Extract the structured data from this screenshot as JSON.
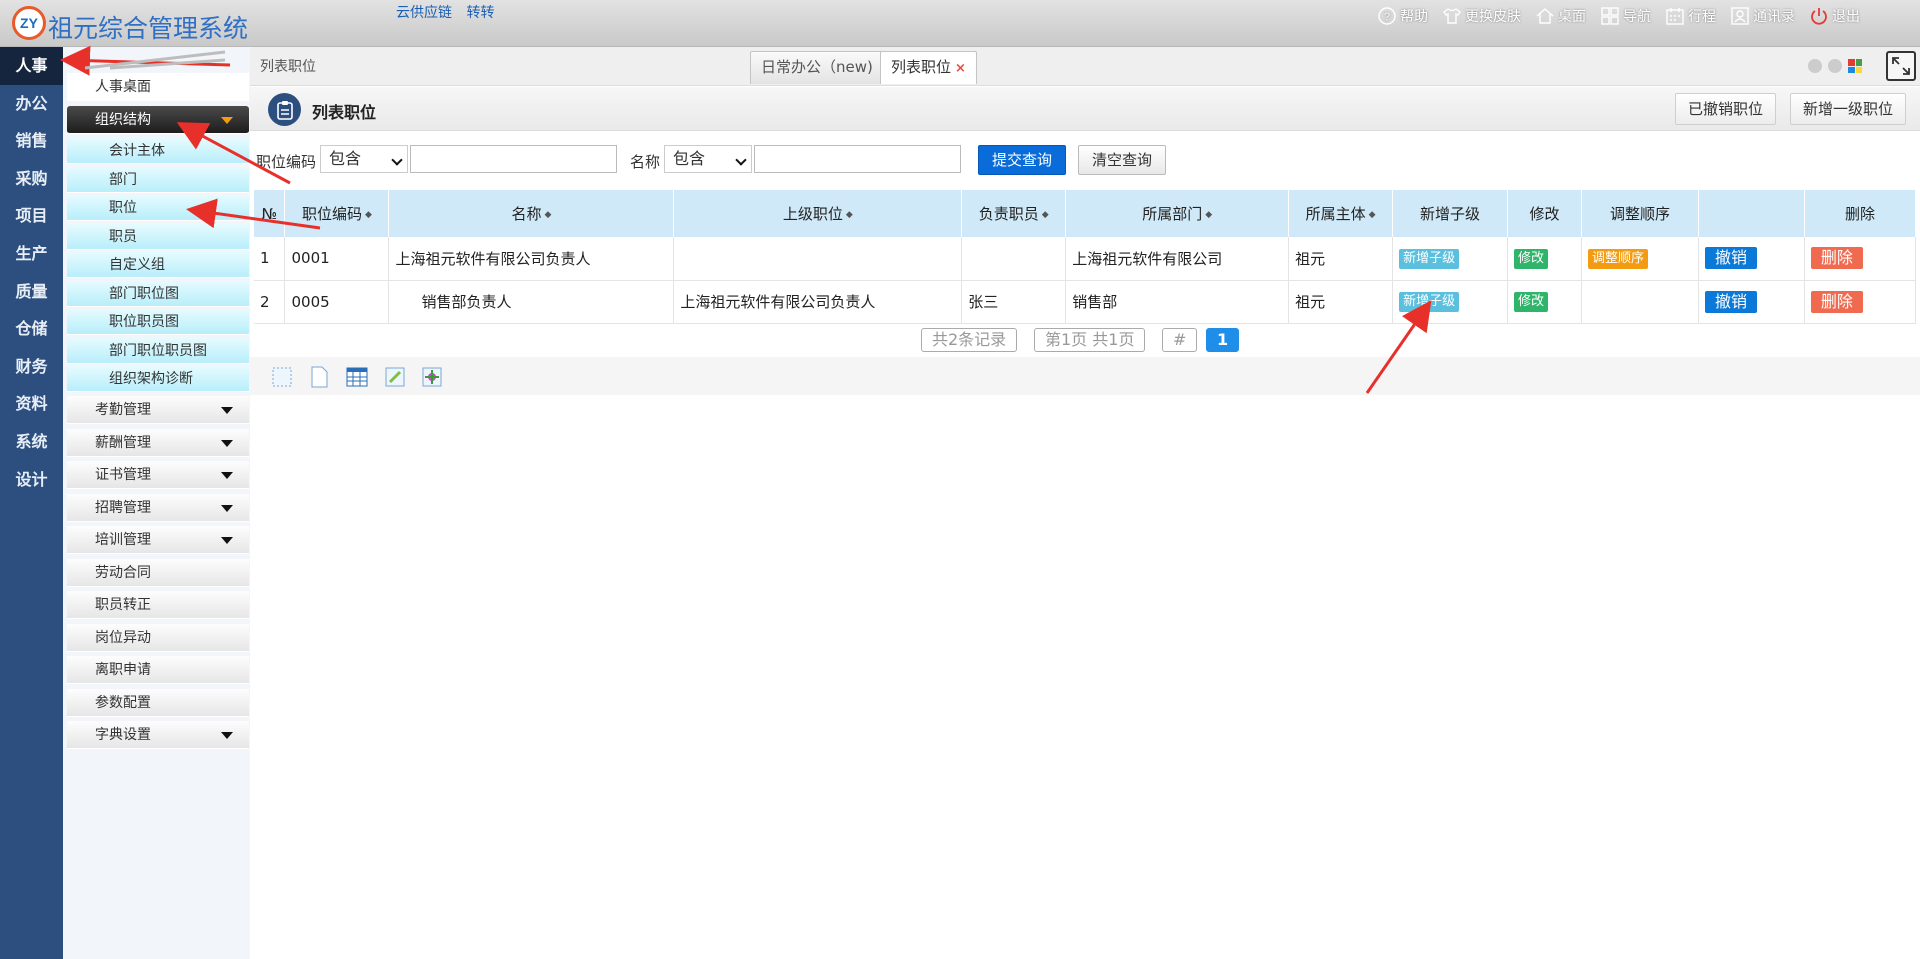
{
  "header": {
    "logo_text": "ZY",
    "app_title": "祖元综合管理系统",
    "links": [
      "云供应链",
      "转转"
    ],
    "tools": [
      {
        "icon": "help-icon",
        "label": "帮助"
      },
      {
        "icon": "shirt-icon",
        "label": "更换皮肤"
      },
      {
        "icon": "home-icon",
        "label": "桌面"
      },
      {
        "icon": "grid-icon",
        "label": "导航"
      },
      {
        "icon": "calendar-icon",
        "label": "行程"
      },
      {
        "icon": "contacts-icon",
        "label": "通讯录"
      },
      {
        "icon": "power-icon",
        "label": "退出"
      }
    ]
  },
  "rail": [
    "人事",
    "办公",
    "销售",
    "采购",
    "项目",
    "生产",
    "质量",
    "仓储",
    "财务",
    "资料",
    "系统",
    "设计"
  ],
  "submenu": {
    "desk": "人事桌面",
    "org": "组织结构",
    "org_children": [
      "会计主体",
      "部门",
      "职位",
      "职员",
      "自定义组",
      "部门职位图",
      "职位职员图",
      "部门职位职员图",
      "组织架构诊断"
    ],
    "groups": [
      "考勤管理",
      "薪酬管理",
      "证书管理",
      "招聘管理",
      "培训管理",
      "劳动合同",
      "职员转正",
      "岗位异动",
      "离职申请",
      "参数配置",
      "字典设置"
    ]
  },
  "content": {
    "breadcrumb": "列表职位",
    "tabs": [
      {
        "label": "日常办公（new)"
      },
      {
        "label": "列表职位",
        "close": "×"
      }
    ],
    "page_title": "列表职位",
    "header_buttons": [
      "已撤销职位",
      "新增一级职位"
    ],
    "search": {
      "code_label": "职位编码",
      "code_op": "包含",
      "name_label": "名称",
      "name_op": "包含",
      "submit": "提交查询",
      "clear": "清空查询"
    },
    "table": {
      "headers": [
        "№",
        "职位编码",
        "名称",
        "上级职位",
        "负责职员",
        "所属部门",
        "所属主体",
        "新增子级",
        "修改",
        "调整顺序",
        "",
        "删除"
      ],
      "rows": [
        {
          "no": "1",
          "code": "0001",
          "name": "上海祖元软件有限公司负责人",
          "parent": "",
          "owner": "",
          "dept": "上海祖元软件有限公司",
          "entity": "祖元",
          "add_child": "新增子级",
          "edit": "修改",
          "reorder": "调整顺序",
          "revoke": "撤销",
          "delete": "删除"
        },
        {
          "no": "2",
          "code": "0005",
          "name": "销售部负责人",
          "parent": "上海祖元软件有限公司负责人",
          "owner": "张三",
          "dept": "销售部",
          "entity": "祖元",
          "add_child": "新增子级",
          "edit": "修改",
          "reorder": "",
          "revoke": "撤销",
          "delete": "删除"
        }
      ]
    },
    "pager": {
      "total": "共2条记录",
      "page": "第1页 共1页",
      "hash": "#",
      "current": "1"
    }
  },
  "colors": {
    "rail_bg": "#2c4f7f",
    "accent": "#0a6cd8",
    "annotation": "#e8302a"
  }
}
